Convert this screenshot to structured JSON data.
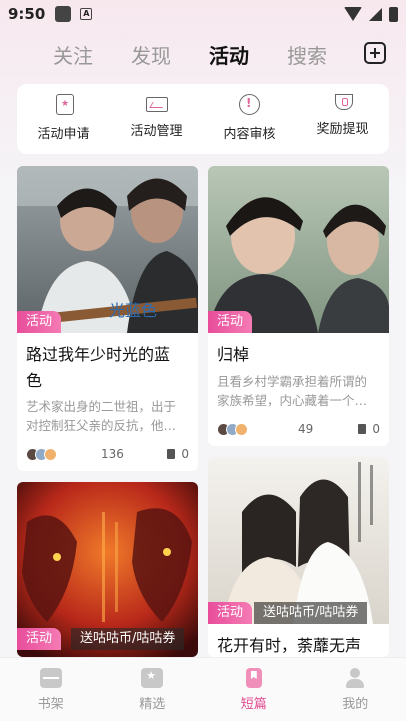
{
  "status_bar": {
    "time": "9:50"
  },
  "top_tabs": [
    {
      "label": "关注",
      "active": false
    },
    {
      "label": "发现",
      "active": false
    },
    {
      "label": "活动",
      "active": true
    },
    {
      "label": "搜索",
      "active": false
    }
  ],
  "quick_actions": [
    {
      "label": "活动申请",
      "icon": "activity-apply-icon"
    },
    {
      "label": "活动管理",
      "icon": "activity-manage-icon"
    },
    {
      "label": "内容审核",
      "icon": "content-review-icon"
    },
    {
      "label": "奖励提现",
      "icon": "reward-withdraw-icon"
    }
  ],
  "cards": [
    {
      "tag": "活动",
      "title": "路过我年少时光的蓝色",
      "title_line1": "路过我年少时光的蓝",
      "title_line2": "色",
      "desc_line1": "艺术家出身的二世祖，出于",
      "desc_line2": "对控制狂父亲的反抗，他…",
      "views": "136",
      "pages": "0",
      "cover_text": "光蓝色"
    },
    {
      "tag": "活动",
      "title": "归棹",
      "desc_line1": "且看乡村学霸承担着所谓的",
      "desc_line2": "家族希望，内心藏着一个…",
      "views": "49",
      "pages": "0"
    },
    {
      "tag": "活动",
      "coin_tag": "送咕咕币/咕咕券"
    },
    {
      "tag": "活动",
      "coin_tag": "送咕咕币/咕咕券",
      "title": "花开有时，荼蘼无声"
    }
  ],
  "bottom_nav": [
    {
      "label": "书架",
      "icon": "bookshelf-icon",
      "active": false
    },
    {
      "label": "精选",
      "icon": "featured-icon",
      "active": false
    },
    {
      "label": "短篇",
      "icon": "short-story-icon",
      "active": true
    },
    {
      "label": "我的",
      "icon": "profile-icon",
      "active": false
    }
  ],
  "colors": {
    "accent": "#e84d9b",
    "background": "#f5f4f6"
  }
}
